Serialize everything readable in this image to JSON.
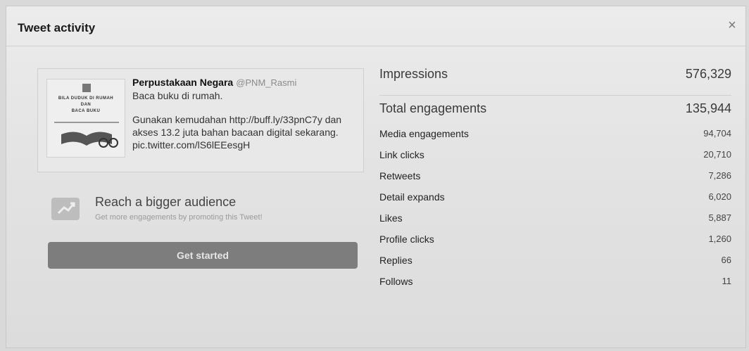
{
  "modal": {
    "title": "Tweet activity",
    "close_icon": "close-icon"
  },
  "tweet": {
    "author_name": "Perpustakaan Negara",
    "author_handle": "@PNM_Rasmi",
    "line1": "Baca buku di rumah.",
    "line2": "Gunakan kemudahan http://buff.ly/33pnC7y dan akses 13.2 juta bahan bacaan digital sekarang. pic.twitter.com/lS6lEEesgH",
    "image": {
      "text1": "BILA DUDUK DI RUMAH",
      "text2": "DAN",
      "text3": "BACA BUKU"
    }
  },
  "promote": {
    "icon": "promote-chart-icon",
    "title": "Reach a bigger audience",
    "subtitle": "Get more engagements by promoting this Tweet!",
    "button_label": "Get started"
  },
  "metrics": {
    "impressions": {
      "label": "Impressions",
      "value": "576,329"
    },
    "total_engagements": {
      "label": "Total engagements",
      "value": "135,944"
    },
    "items": [
      {
        "label": "Media engagements",
        "value": "94,704"
      },
      {
        "label": "Link clicks",
        "value": "20,710"
      },
      {
        "label": "Retweets",
        "value": "7,286"
      },
      {
        "label": "Detail expands",
        "value": "6,020"
      },
      {
        "label": "Likes",
        "value": "5,887"
      },
      {
        "label": "Profile clicks",
        "value": "1,260"
      },
      {
        "label": "Replies",
        "value": "66"
      },
      {
        "label": "Follows",
        "value": "11"
      }
    ]
  }
}
